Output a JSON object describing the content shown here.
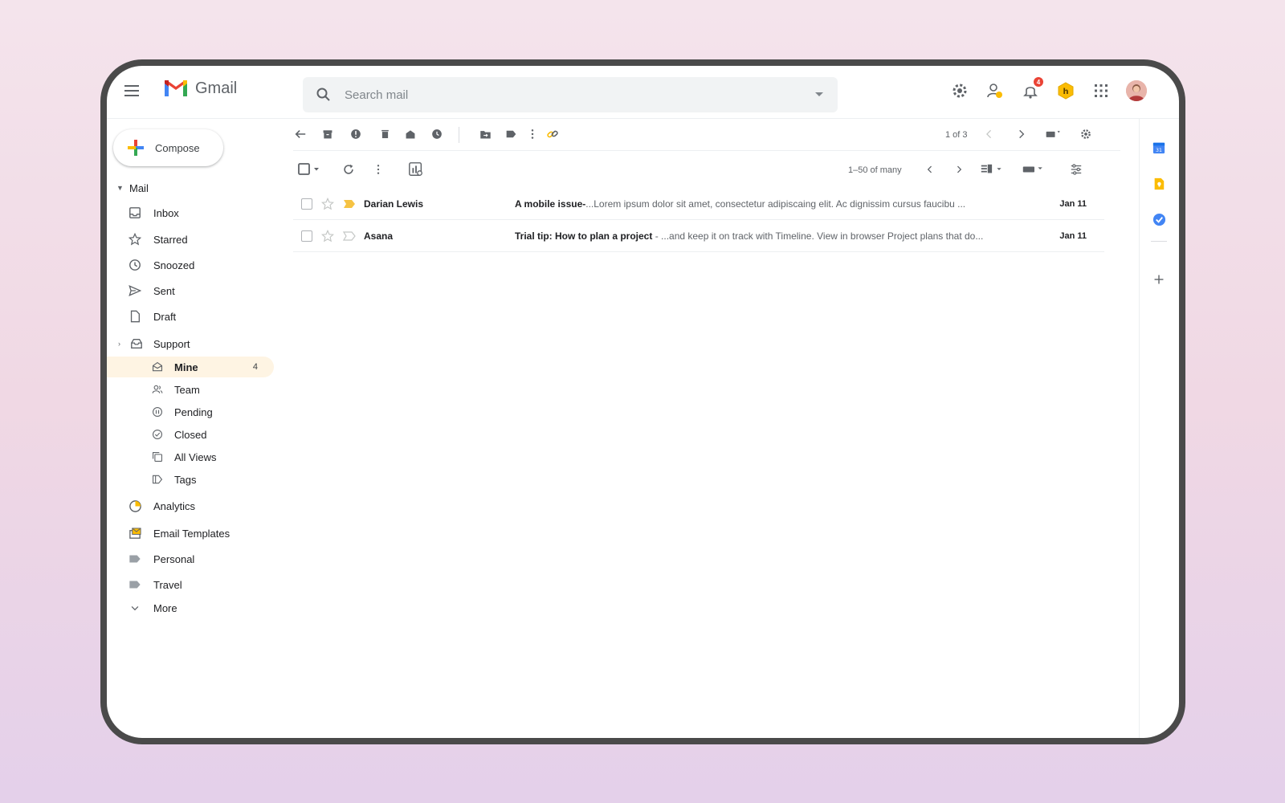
{
  "app": {
    "name": "Gmail"
  },
  "search": {
    "placeholder": "Search mail"
  },
  "header": {
    "notification_count": "4"
  },
  "compose": {
    "label": "Compose"
  },
  "sidebar": {
    "mail_label": "Mail",
    "items": [
      {
        "label": "Inbox",
        "icon": "inbox-icon"
      },
      {
        "label": "Starred",
        "icon": "star-icon"
      },
      {
        "label": "Snoozed",
        "icon": "clock-icon"
      },
      {
        "label": "Sent",
        "icon": "send-icon"
      },
      {
        "label": "Draft",
        "icon": "draft-icon"
      }
    ],
    "support": {
      "label": "Support",
      "children": [
        {
          "label": "Mine",
          "count": "4",
          "active": true
        },
        {
          "label": "Team"
        },
        {
          "label": "Pending"
        },
        {
          "label": "Closed"
        },
        {
          "label": "All Views"
        },
        {
          "label": "Tags"
        }
      ]
    },
    "more_items": [
      {
        "label": "Analytics"
      },
      {
        "label": "Email Templates"
      },
      {
        "label": "Personal"
      },
      {
        "label": "Travel"
      },
      {
        "label": "More"
      }
    ]
  },
  "toolbar": {
    "pager": "1 of 3"
  },
  "listbar": {
    "range": "1–50 of many"
  },
  "emails": [
    {
      "sender": "Darian Lewis",
      "subject": "A mobile issue-",
      "snippet": "...Lorem ipsum dolor sit amet, consectetur adipiscaing elit. Ac dignissim cursus faucibu ...",
      "date": "Jan 11",
      "important": true
    },
    {
      "sender": "Asana",
      "subject": "Trial tip: How to plan a project",
      "snippet": " - ...and keep it on track with Timeline. View in browser Project plans that do...",
      "date": "Jan 11",
      "important": false
    }
  ],
  "colors": {
    "accent_yellow": "#fbbc04",
    "active_bg": "#fef4e3",
    "badge_red": "#ea4335"
  }
}
